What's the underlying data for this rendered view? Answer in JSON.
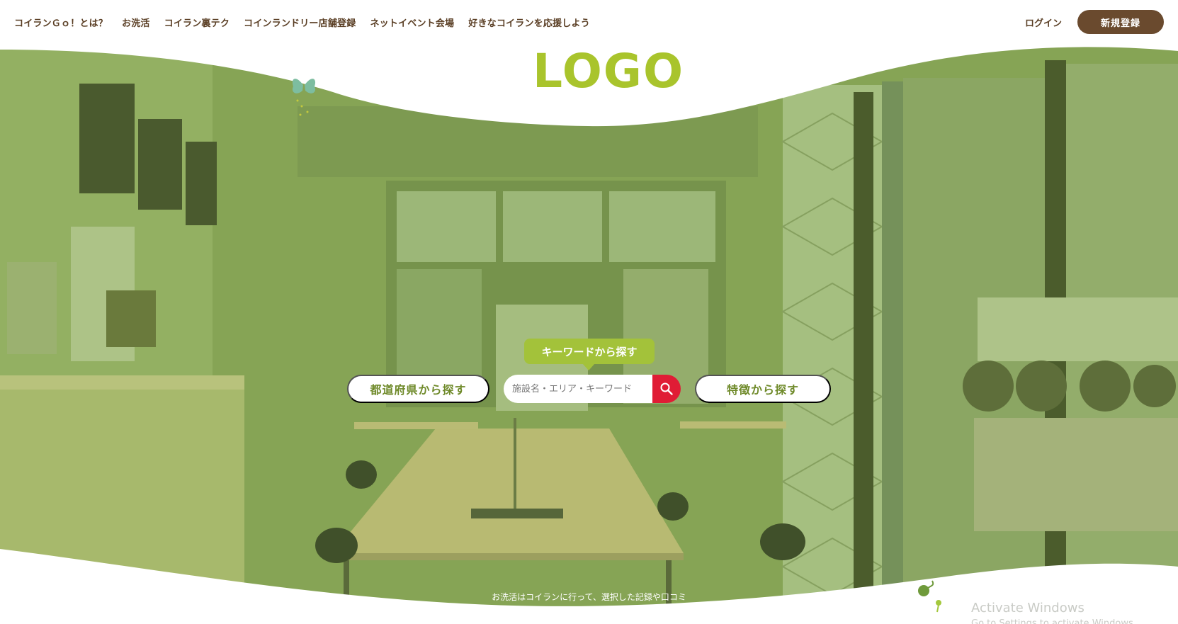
{
  "nav": {
    "items": [
      {
        "label": "コイランＧｏ！とは？"
      },
      {
        "label": "お洗活"
      },
      {
        "label": "コイラン裏テク"
      },
      {
        "label": "コインランドリー店舗登録"
      },
      {
        "label": "ネットイベント会場"
      },
      {
        "label": "好きなコイランを応援しよう"
      }
    ],
    "login": "ログイン",
    "signup": "新規登録"
  },
  "logo": "LOGO",
  "search": {
    "keyword_label": "キーワードから探す",
    "prefecture_button": "都道府県から探す",
    "feature_button": "特徴から探す",
    "placeholder": "施設名・エリア・キーワード"
  },
  "tagline": "お洗活はコイランに行って、選択した記録や口コミ",
  "windows": {
    "line1": "Activate Windows",
    "line2": "Go to Settings to activate Windows."
  },
  "colors": {
    "brand_green": "#a9c42c",
    "overlay_green": "#8fae56",
    "brown": "#6a4a2e",
    "search_red": "#e01c35"
  }
}
